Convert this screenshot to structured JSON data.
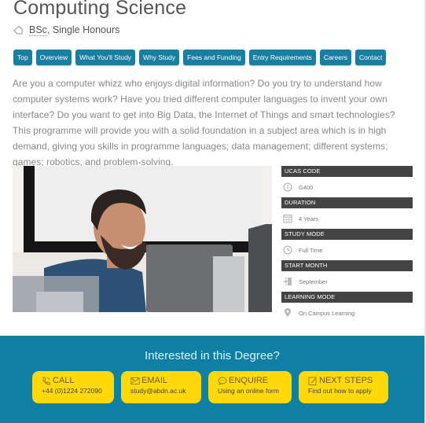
{
  "header": {
    "title": "Computing Science",
    "degree_abbr": "BSc",
    "degree_rest": ", Single Honours",
    "tag_icon": "tag-icon"
  },
  "nav": {
    "items": [
      {
        "label": "Top"
      },
      {
        "label": "Overview"
      },
      {
        "label": "What You'll Study"
      },
      {
        "label": "Why Study"
      },
      {
        "label": "Fees and Funding"
      },
      {
        "label": "Entry Requirements"
      },
      {
        "label": "Careers"
      },
      {
        "label": "Contact"
      }
    ]
  },
  "intro": "Are you a computer whizz who enjoys digital information? Do you try to understand how computer systems work? Have you tried different computer languages to invent your own interface? Do you want to get into Big Data, the Internet of Things and smart technologies? This programme will provide you with a solid foundation in a subject area which is in high demand, giving you skills in programme languages; data management; different systems; games; robotics, and problem-solving.",
  "photo": {
    "description": "Smiling bearded student in blue t-shirt looking at a computer monitor"
  },
  "facts": [
    {
      "label": "UCAS CODE",
      "value": "G400",
      "icon": "info-icon"
    },
    {
      "label": "DURATION",
      "value": "4 Years",
      "icon": "calendar-icon"
    },
    {
      "label": "STUDY MODE",
      "value": "Full Time",
      "icon": "clock-icon"
    },
    {
      "label": "START MONTH",
      "value": "September",
      "icon": "door-enter-icon"
    },
    {
      "label": "LEARNING MODE",
      "value": "On Campus Learning",
      "icon": "location-pin-icon"
    }
  ],
  "cta": {
    "title": "Interested in this Degree?",
    "buttons": [
      {
        "label": "CALL",
        "sub": "+44 (0)1224 272090",
        "icon": "phone-icon"
      },
      {
        "label": "EMAIL",
        "sub": "study@abdn.ac.uk",
        "icon": "envelope-icon"
      },
      {
        "label": "ENQUIRE",
        "sub": "Using an online form",
        "icon": "chat-bubble-icon"
      },
      {
        "label": "NEXT STEPS",
        "sub": "Find out how to apply",
        "icon": "edit-icon"
      }
    ]
  },
  "colors": {
    "nav_button": "#1a7ea1",
    "fact_header": "#444444",
    "cta_background": "#0f7fa3",
    "cta_button": "#ffd90a"
  }
}
